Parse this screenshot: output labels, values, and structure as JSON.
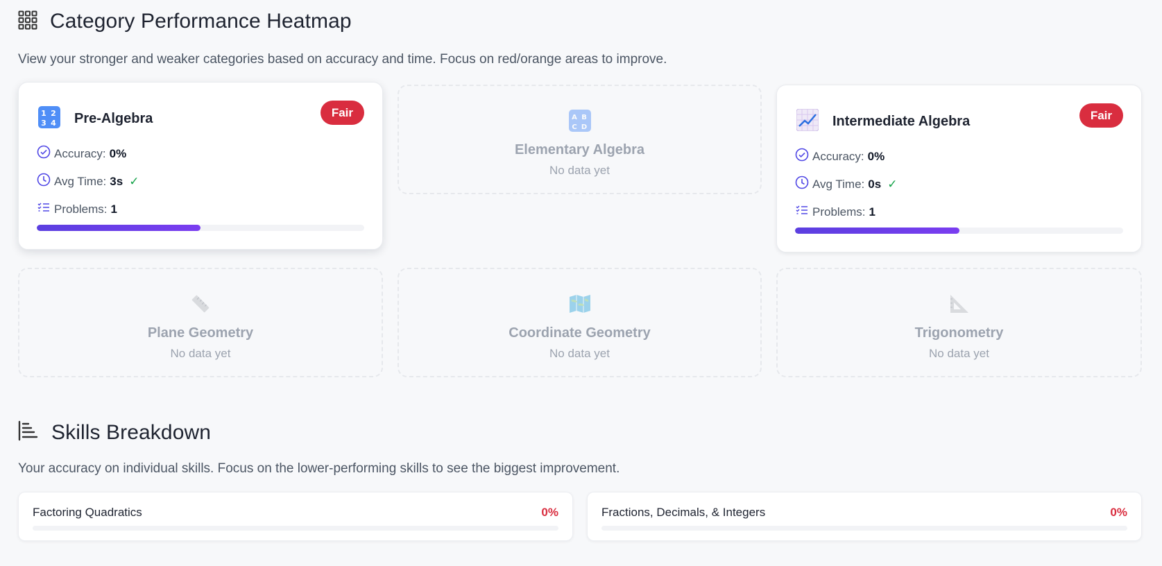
{
  "heatmap": {
    "title": "Category Performance Heatmap",
    "description": "View your stronger and weaker categories based on accuracy and time. Focus on red/orange areas to improve.",
    "stat_labels": {
      "accuracy": "Accuracy:",
      "avg_time": "Avg Time:",
      "problems": "Problems:"
    },
    "check_glyph": "✓",
    "categories": [
      {
        "name": "Pre-Algebra",
        "icon": "numbers-1234-icon",
        "badge": "Fair",
        "accuracy": "0%",
        "avg_time": "3s",
        "problems": "1",
        "progress": 0.5
      },
      {
        "name": "Elementary Algebra",
        "icon": "abcd-icon",
        "status": "No data yet"
      },
      {
        "name": "Intermediate Algebra",
        "icon": "chart-increasing-icon",
        "badge": "Fair",
        "accuracy": "0%",
        "avg_time": "0s",
        "problems": "1",
        "progress": 0.5
      },
      {
        "name": "Plane Geometry",
        "icon": "ruler-icon",
        "status": "No data yet"
      },
      {
        "name": "Coordinate Geometry",
        "icon": "map-icon",
        "status": "No data yet"
      },
      {
        "name": "Trigonometry",
        "icon": "triangular-ruler-icon",
        "status": "No data yet"
      }
    ]
  },
  "skills": {
    "title": "Skills Breakdown",
    "description": "Your accuracy on individual skills. Focus on the lower-performing skills to see the biggest improvement.",
    "items": [
      {
        "name": "Factoring Quadratics",
        "percent": "0%"
      },
      {
        "name": "Fractions, Decimals, & Integers",
        "percent": "0%"
      }
    ]
  },
  "colors": {
    "badge_red": "#d92d3f",
    "accent_purple": "#5b3fe0",
    "check_green": "#16a34a",
    "icon_indigo": "#4f46e5"
  }
}
